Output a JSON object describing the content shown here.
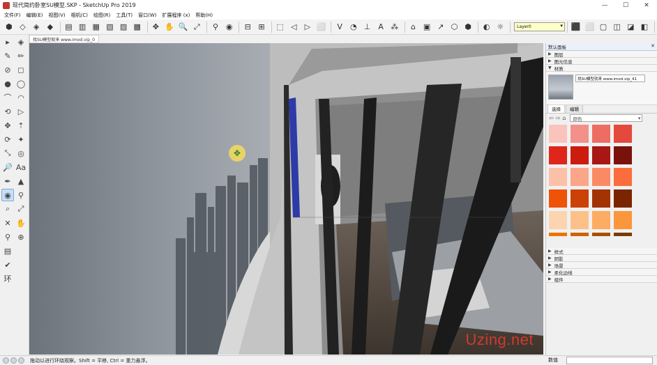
{
  "window": {
    "title": "现代简约卧室SU模型.SKP - SketchUp Pro 2019",
    "minimize": "—",
    "maximize": "☐",
    "close": "✕"
  },
  "menu": [
    "文件(F)",
    "编辑(E)",
    "视图(V)",
    "相机(C)",
    "绘图(R)",
    "工具(T)",
    "窗口(W)",
    "扩展程序 (x)",
    "帮助(H)"
  ],
  "toolbar": {
    "layer_value": "Layer0",
    "layer_dropdown_icon": "▾",
    "groups": [
      [
        "select-icon",
        "eraser-icon",
        "make-component-icon",
        "paint-bucket-icon"
      ],
      [
        "xray-style-icon",
        "back-edges-style-icon",
        "wireframe-style-icon",
        "hidden-line-style-icon",
        "shaded-style-icon",
        "shaded-textures-style-icon"
      ],
      [
        "orbit-icon",
        "pan-icon",
        "zoom-icon",
        "zoom-extents-icon"
      ],
      [
        "walk-icon",
        "look-around-icon"
      ],
      [
        "section-plane-icon",
        "section-display-icon"
      ],
      [
        "camera-icon",
        "previous-view-icon",
        "next-view-icon",
        "standard-view-icon"
      ],
      [
        "dimension-icon",
        "protractor-icon",
        "axes-icon",
        "text-icon",
        "3d-text-icon"
      ],
      [
        "warehouse-icon",
        "component-icon",
        "share-icon",
        "extension-icon",
        "ruby-icon"
      ],
      [
        "styles-icon",
        "shadow-icon"
      ],
      [
        "iso-view-icon",
        "top-view-icon",
        "front-view-icon",
        "right-view-icon",
        "back-view-icon",
        "left-view-icon"
      ]
    ],
    "glyphs": [
      "⬢",
      "◇",
      "◈",
      "◆",
      "▤",
      "▥",
      "▦",
      "▧",
      "▨",
      "▩",
      "✥",
      "✋",
      "🔍",
      "⤢",
      "⚲",
      "◉",
      "⊟",
      "⊞",
      "⬚",
      "◁",
      "▷",
      "⬜",
      "Ⅴ",
      "◔",
      "⊥",
      "A",
      "⁂",
      "⌂",
      "▣",
      "↗",
      "⬡",
      "⬢",
      "◐",
      "☼",
      "⬛",
      "⬜",
      "▢",
      "◫",
      "◪",
      "◧"
    ]
  },
  "left_tools": [
    [
      "▸",
      "◈"
    ],
    [
      "✎",
      "✏"
    ],
    [
      "⊘",
      "◻"
    ],
    [
      "●",
      "◯"
    ],
    [
      "⌒",
      "◠"
    ],
    [
      "⟲",
      "▷"
    ],
    [
      "✥",
      "⇡"
    ],
    [
      "⟳",
      "✦"
    ],
    [
      "⤡",
      "◎"
    ],
    [
      "🔎",
      "Aa"
    ],
    [
      "✒",
      "▲"
    ],
    [
      "◉",
      "⚲"
    ],
    [
      "⌕",
      "⤢"
    ],
    [
      "✕",
      "✋"
    ],
    [
      "⚲",
      "⊕"
    ],
    [
      "▤",
      ""
    ],
    [
      "✔",
      ""
    ],
    [
      "环",
      ""
    ]
  ],
  "left_tools_active_index": 11,
  "scene_tab": "找SU模型就来 www.imod.vip_0",
  "viewport": {
    "orbit_cursor_icon": "orbit-cursor-icon",
    "watermark": "Uzing.net"
  },
  "tray": {
    "title": "默认面板",
    "control": "✕",
    "sections_top": [
      {
        "name": "图层",
        "state": "collapsed"
      },
      {
        "name": "图元信息",
        "state": "collapsed"
      },
      {
        "name": "材质",
        "state": "expanded"
      }
    ],
    "material": {
      "name": "找SU模型就来 www.imod.vip_41",
      "tabs": [
        "选择",
        "编辑"
      ],
      "active_tab": "选择",
      "category": "颜色",
      "swatches": [
        "#fac4bd",
        "#f2908a",
        "#ee6d63",
        "#e5483d",
        "#e0261c",
        "#cc1c10",
        "#a81713",
        "#7a120b",
        "#fbc0a8",
        "#fba589",
        "#fb8a64",
        "#fb6d3d",
        "#ee5308",
        "#cc4105",
        "#a33302",
        "#7a2500",
        "#fcd4b0",
        "#fcc189",
        "#fcac63",
        "#fb963c",
        "#ee7400",
        "#cc6400",
        "#a85000",
        "#7a3a00"
      ],
      "side_icons": [
        "home-icon",
        "sample-icon",
        "create-icon"
      ]
    },
    "sections_bottom": [
      "样式",
      "阴影",
      "场景",
      "柔化边线",
      "组件"
    ]
  },
  "status": {
    "text": "拖动以进行环绕观察。Shift = 平移, Ctrl = 重力悬浮。",
    "measure_label": "数值",
    "measure_value": ""
  }
}
